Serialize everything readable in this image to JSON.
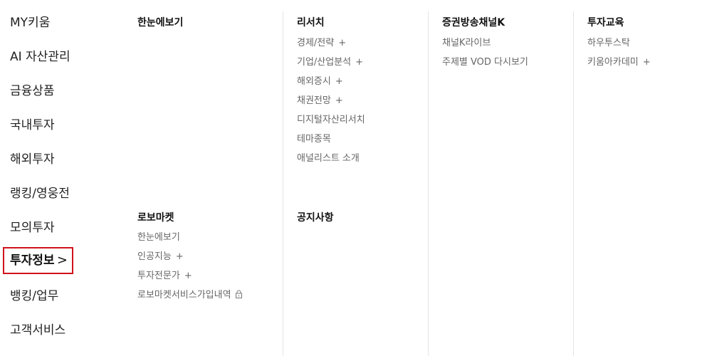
{
  "left_nav": [
    "MY키움",
    "AI 자산관리",
    "금융상품",
    "국내투자",
    "해외투자",
    "랭킹/영웅전",
    "모의투자",
    "투자정보",
    "뱅킹/업무",
    "고객서비스"
  ],
  "active_chevron": ">",
  "plus_symbol": "+",
  "col1": {
    "title": "한눈에보기",
    "robo": {
      "title": "로보마켓",
      "items": [
        "한눈에보기",
        "인공지능",
        "투자전문가",
        "로보마켓서비스가입내역"
      ]
    }
  },
  "col2": {
    "title": "리서치",
    "items": [
      "경제/전략",
      "기업/산업분석",
      "해외증시",
      "채권전망",
      "디지털자산리서치",
      "테마종목",
      "애널리스트 소개"
    ],
    "notice_title": "공지사항"
  },
  "col3": {
    "title": "증권방송채널K",
    "items": [
      "채널K라이브",
      "주제별 VOD 다시보기"
    ]
  },
  "col4": {
    "title": "투자교육",
    "items": [
      "하우투스탁",
      "키움아카데미"
    ]
  },
  "icons": {
    "lock": "lock-icon"
  }
}
